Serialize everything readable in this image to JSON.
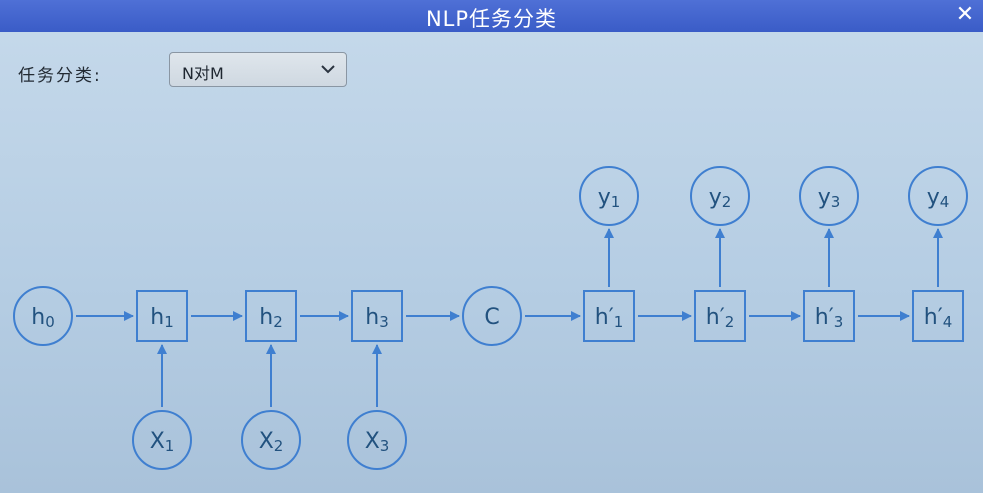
{
  "window": {
    "title": "NLP任务分类",
    "close_icon": "close-icon"
  },
  "controls": {
    "task_label": "任务分类:",
    "task_select_value": "N对M"
  },
  "diagram": {
    "colors": {
      "stroke": "#3f7fd0",
      "text": "#22527f"
    },
    "h0": {
      "base": "h",
      "sub": "0"
    },
    "encoder_states": [
      {
        "base": "h",
        "sub": "1"
      },
      {
        "base": "h",
        "sub": "2"
      },
      {
        "base": "h",
        "sub": "3"
      }
    ],
    "inputs": [
      {
        "base": "X",
        "sub": "1"
      },
      {
        "base": "X",
        "sub": "2"
      },
      {
        "base": "X",
        "sub": "3"
      }
    ],
    "context": {
      "base": "C",
      "sub": ""
    },
    "decoder_states": [
      {
        "base": "h′",
        "sub": "1"
      },
      {
        "base": "h′",
        "sub": "2"
      },
      {
        "base": "h′",
        "sub": "3"
      },
      {
        "base": "h′",
        "sub": "4"
      }
    ],
    "outputs": [
      {
        "base": "y",
        "sub": "1"
      },
      {
        "base": "y",
        "sub": "2"
      },
      {
        "base": "y",
        "sub": "3"
      },
      {
        "base": "y",
        "sub": "4"
      }
    ]
  }
}
